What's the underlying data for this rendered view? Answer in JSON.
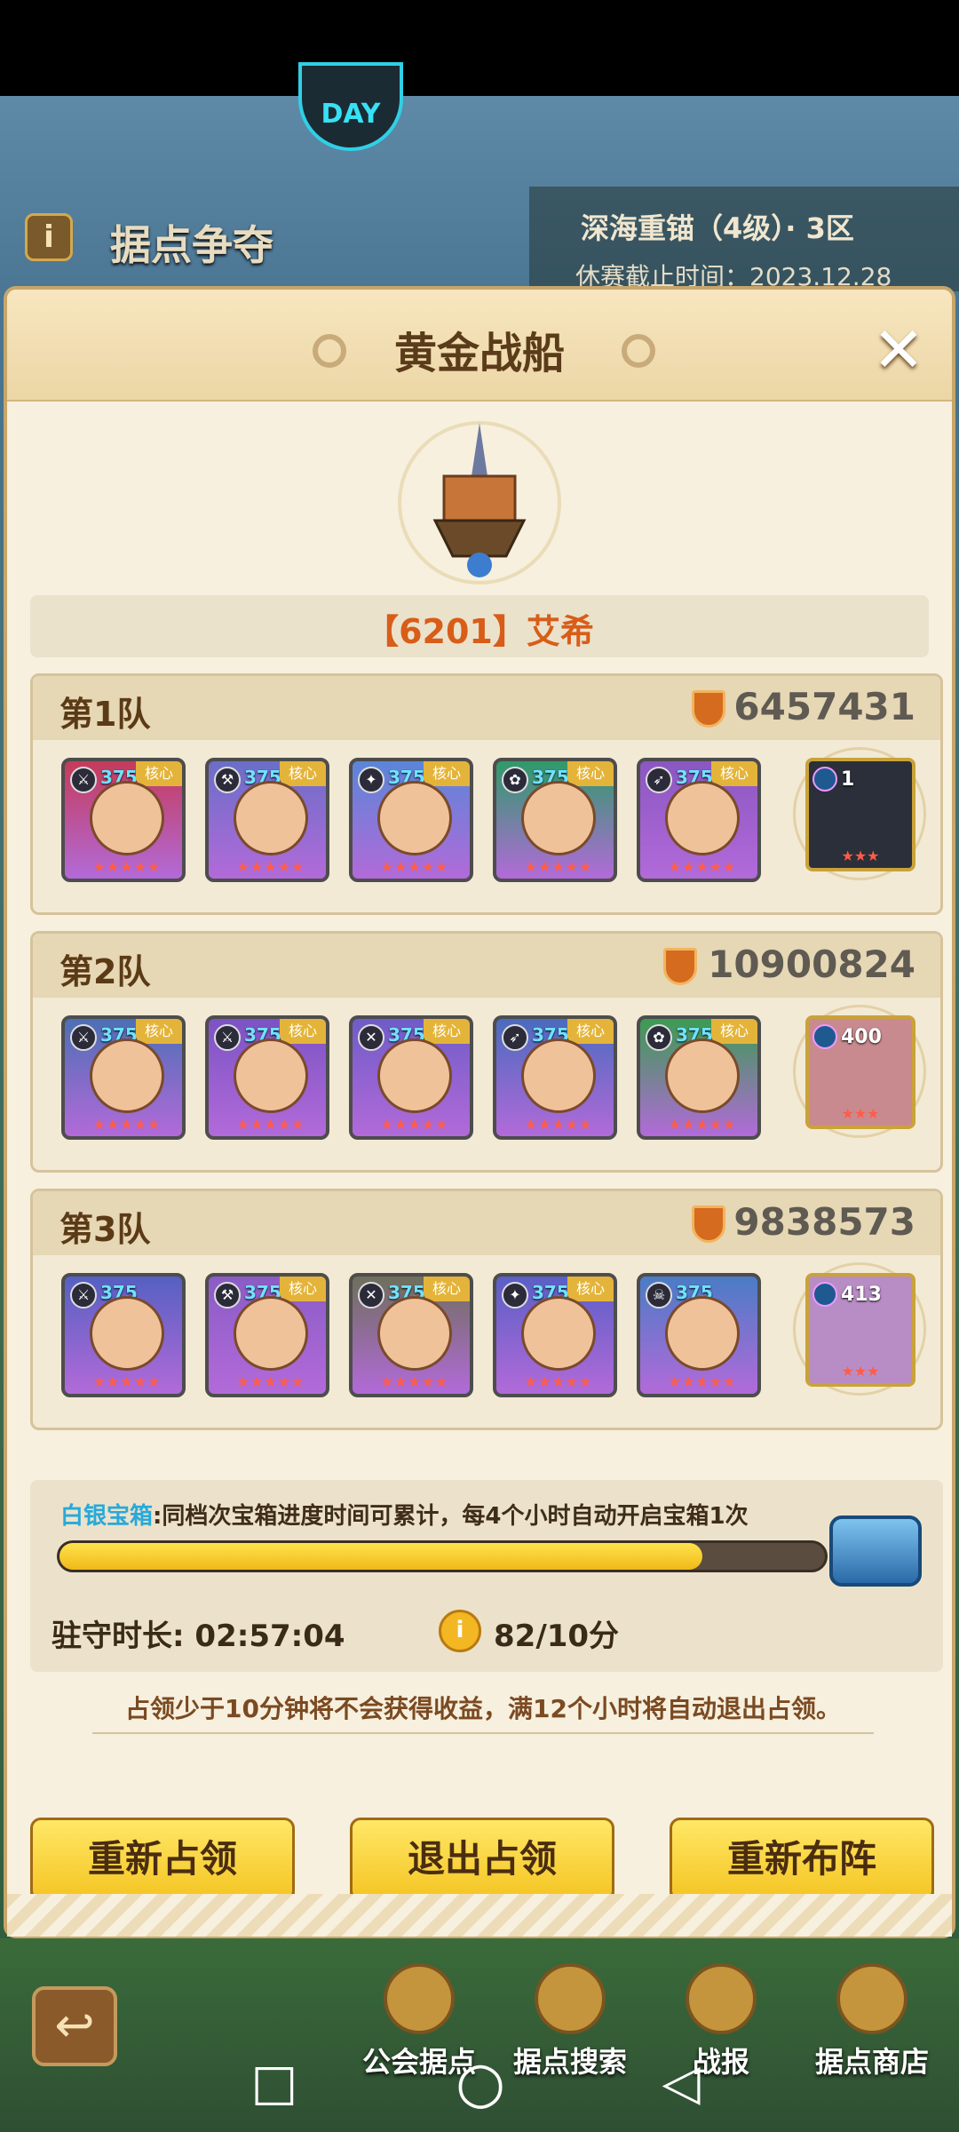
{
  "top_badge": "DAY",
  "event": {
    "title": "据点争夺",
    "info_icon": "i"
  },
  "season": {
    "name": "深海重锚（4级）· 3区",
    "deadline": "休赛截止时间：2023.12.28"
  },
  "dialog": {
    "title": "黄金战船",
    "close": "✕",
    "owner": "【6201】艾希",
    "teams": [
      {
        "label": "第1队",
        "power": "6457431",
        "heroes": [
          {
            "level": "375",
            "core": "核心",
            "color": "#c53b5a"
          },
          {
            "level": "375",
            "core": "核心",
            "color": "#6a6ec8"
          },
          {
            "level": "375",
            "core": "核心",
            "color": "#5a86d8"
          },
          {
            "level": "375",
            "core": "核心",
            "color": "#2f9a6a"
          },
          {
            "level": "375",
            "core": "核心",
            "color": "#8a57c2"
          }
        ],
        "pet": {
          "level": "1",
          "color": "#2b2f3a"
        }
      },
      {
        "label": "第2队",
        "power": "10900824",
        "heroes": [
          {
            "level": "375",
            "core": "核心",
            "color": "#4c6fb5"
          },
          {
            "level": "375",
            "core": "核心",
            "color": "#7b53c4"
          },
          {
            "level": "375",
            "core": "核心",
            "color": "#6f5cc8"
          },
          {
            "level": "375",
            "core": "核心",
            "color": "#4a6bbf"
          },
          {
            "level": "375",
            "core": "核心",
            "color": "#3c9b52"
          }
        ],
        "pet": {
          "level": "400",
          "color": "#c98a8f"
        }
      },
      {
        "label": "第3队",
        "power": "9838573",
        "heroes": [
          {
            "level": "375",
            "core": "",
            "color": "#5660c2"
          },
          {
            "level": "375",
            "core": "核心",
            "color": "#8a5cc6"
          },
          {
            "level": "375",
            "core": "核心",
            "color": "#6f6f5c"
          },
          {
            "level": "375",
            "core": "核心",
            "color": "#5a5fc6"
          },
          {
            "level": "375",
            "core": "",
            "color": "#4a7cc6"
          }
        ],
        "pet": {
          "level": "413",
          "color": "#b88dc5"
        }
      }
    ],
    "chest": {
      "name": "白银宝箱",
      "description": ":同档次宝箱进度时间可累计，每4个小时自动开启宝箱1次",
      "progress": 0.84
    },
    "guard_time": "驻守时长: 02:57:04",
    "coin_icon": "i",
    "coin_rate": "82/10分",
    "notice": "占领少于10分钟将不会获得收益，满12个小时将自动退出占领。",
    "buttons": {
      "reoccupy": "重新占领",
      "exit": "退出占领",
      "redeploy": "重新布阵"
    }
  },
  "bottom_nav": [
    {
      "label": "公会据点",
      "icon": "guild-stronghold-icon"
    },
    {
      "label": "据点搜索",
      "icon": "stronghold-search-icon"
    },
    {
      "label": "战报",
      "icon": "battle-report-icon"
    },
    {
      "label": "据点商店",
      "icon": "stronghold-shop-icon"
    }
  ],
  "back_icon": "↩",
  "android": {
    "recent": "□",
    "home": "○",
    "back": "◁"
  },
  "stars": "★★★★★",
  "pet_stars": "★★★"
}
